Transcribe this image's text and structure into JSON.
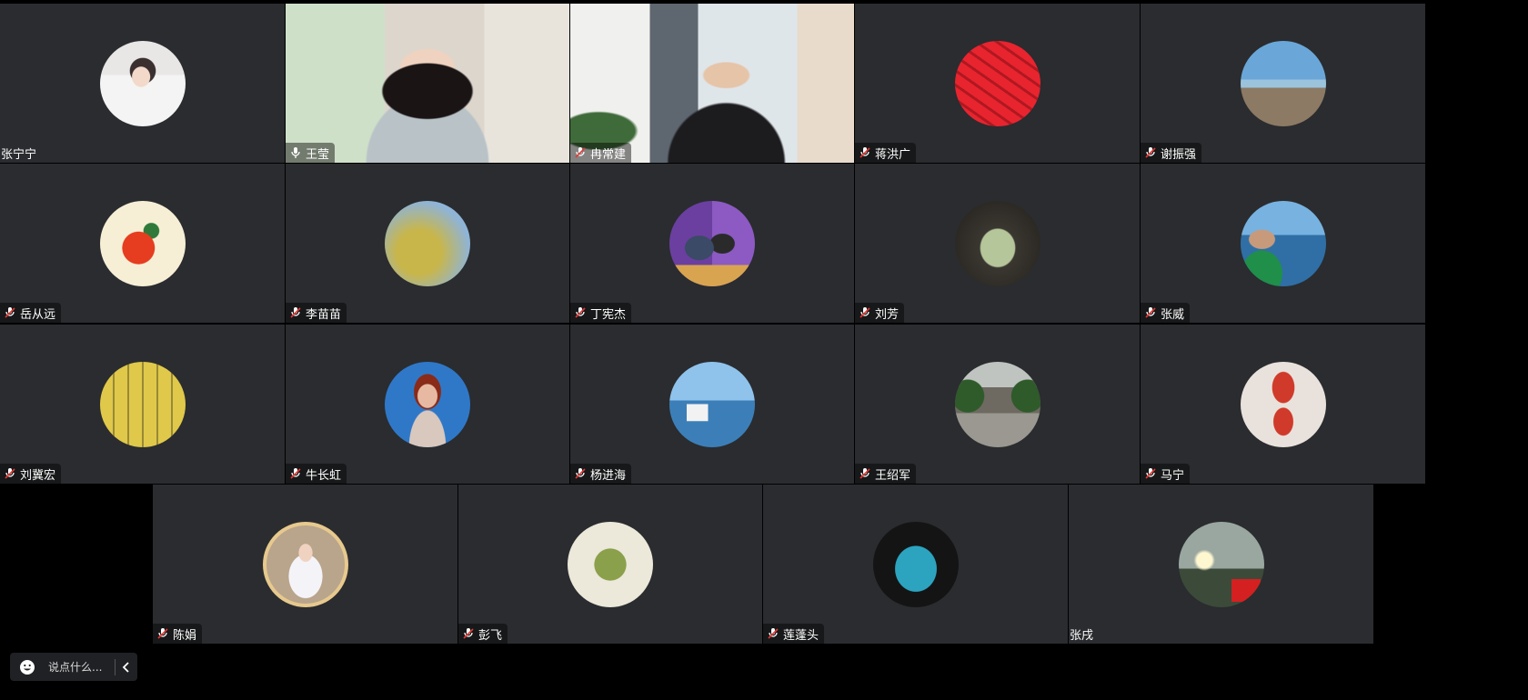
{
  "participants": [
    {
      "name": "张宁宁",
      "muted": false,
      "avatar": "portrait-white-shirt"
    },
    {
      "name": "王莹",
      "muted": false,
      "video": true,
      "speaking": true
    },
    {
      "name": "冉常建",
      "muted": true,
      "video": true
    },
    {
      "name": "蒋洪广",
      "muted": true,
      "avatar": "red-calligraphy"
    },
    {
      "name": "谢振强",
      "muted": true,
      "avatar": "beach-rocks"
    },
    {
      "name": "岳从远",
      "muted": true,
      "avatar": "red-fruit-bouquet"
    },
    {
      "name": "李苗苗",
      "muted": true,
      "avatar": "yellow-blossoms"
    },
    {
      "name": "丁宪杰",
      "muted": true,
      "avatar": "two-people-purple"
    },
    {
      "name": "刘芳",
      "muted": true,
      "avatar": "stone-arch-view"
    },
    {
      "name": "张威",
      "muted": true,
      "avatar": "man-sunglasses-sea"
    },
    {
      "name": "刘冀宏",
      "muted": true,
      "avatar": "ink-symbol-yellow"
    },
    {
      "name": "牛长虹",
      "muted": true,
      "avatar": "woman-blue-portrait"
    },
    {
      "name": "杨进海",
      "muted": true,
      "avatar": "sea-table"
    },
    {
      "name": "王绍军",
      "muted": true,
      "avatar": "building-steps"
    },
    {
      "name": "马宁",
      "muted": true,
      "avatar": "red-calligraphy-paper"
    },
    {
      "name": "陈娟",
      "muted": true,
      "avatar": "opera-costume"
    },
    {
      "name": "彭飞",
      "muted": true,
      "avatar": "owl-figurine"
    },
    {
      "name": "莲蓬头",
      "muted": true,
      "avatar": "turquoise-carving"
    },
    {
      "name": "张戌",
      "muted": false,
      "avatar": "sunset-sky-flag"
    }
  ],
  "chat": {
    "placeholder": "说点什么...",
    "emoji_icon": "smiley-icon",
    "collapse_icon": "chevron-left-icon"
  },
  "colors": {
    "tile_bg": "#2a2c2f",
    "speaking_border": "#17c964",
    "page_bg": "#000000"
  }
}
